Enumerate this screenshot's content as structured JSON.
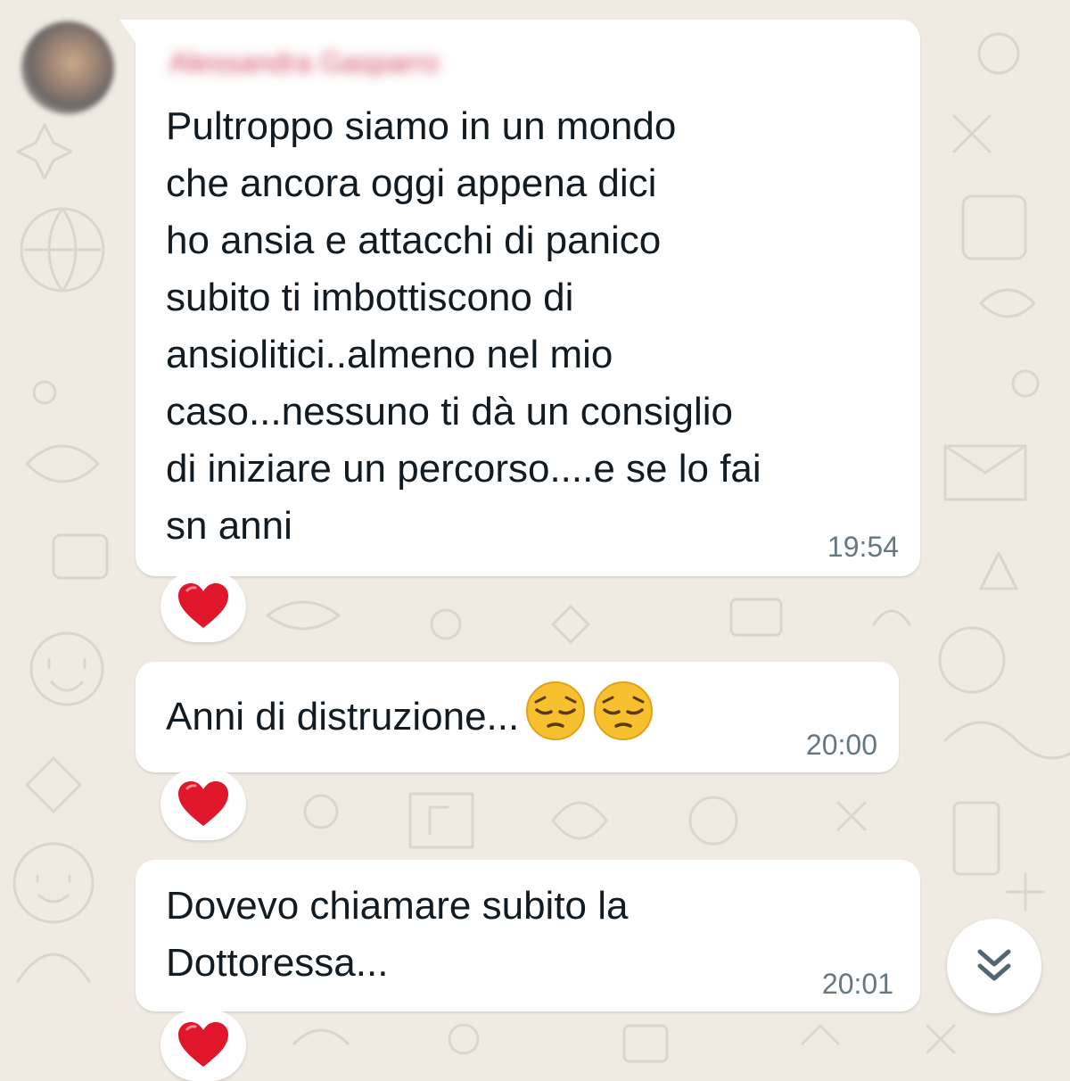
{
  "chat": {
    "sender": {
      "name": "Alessandra Gasparro",
      "avatar": "blurred-avatar"
    },
    "messages": [
      {
        "text": "Pultroppo siamo in un mondo\nche ancora oggi appena dici\nho ansia e attacchi di panico\nsubito ti imbottiscono di\nansiolitici..almeno nel mio\ncaso...nessuno ti dà un consiglio\ndi iniziare un percorso....e se lo fai\nsn anni",
        "time": "19:54",
        "reaction": "red-heart"
      },
      {
        "text": "Anni di distruzione...",
        "emojis": [
          "pensive-face",
          "pensive-face"
        ],
        "time": "20:00",
        "reaction": "red-heart"
      },
      {
        "text": "Dovevo chiamare subito la\nDottoressa...",
        "time": "20:01",
        "reaction": "red-heart"
      }
    ]
  },
  "controls": {
    "scroll_down_icon": "double-chevron-down-icon"
  },
  "colors": {
    "wallpaper": "#efeae2",
    "bubble": "#ffffff",
    "text": "#111b21",
    "timestamp": "#667781",
    "sender_name": "#d0495f",
    "heart": "#e0162b",
    "emoji_face": "#f7c02e"
  }
}
